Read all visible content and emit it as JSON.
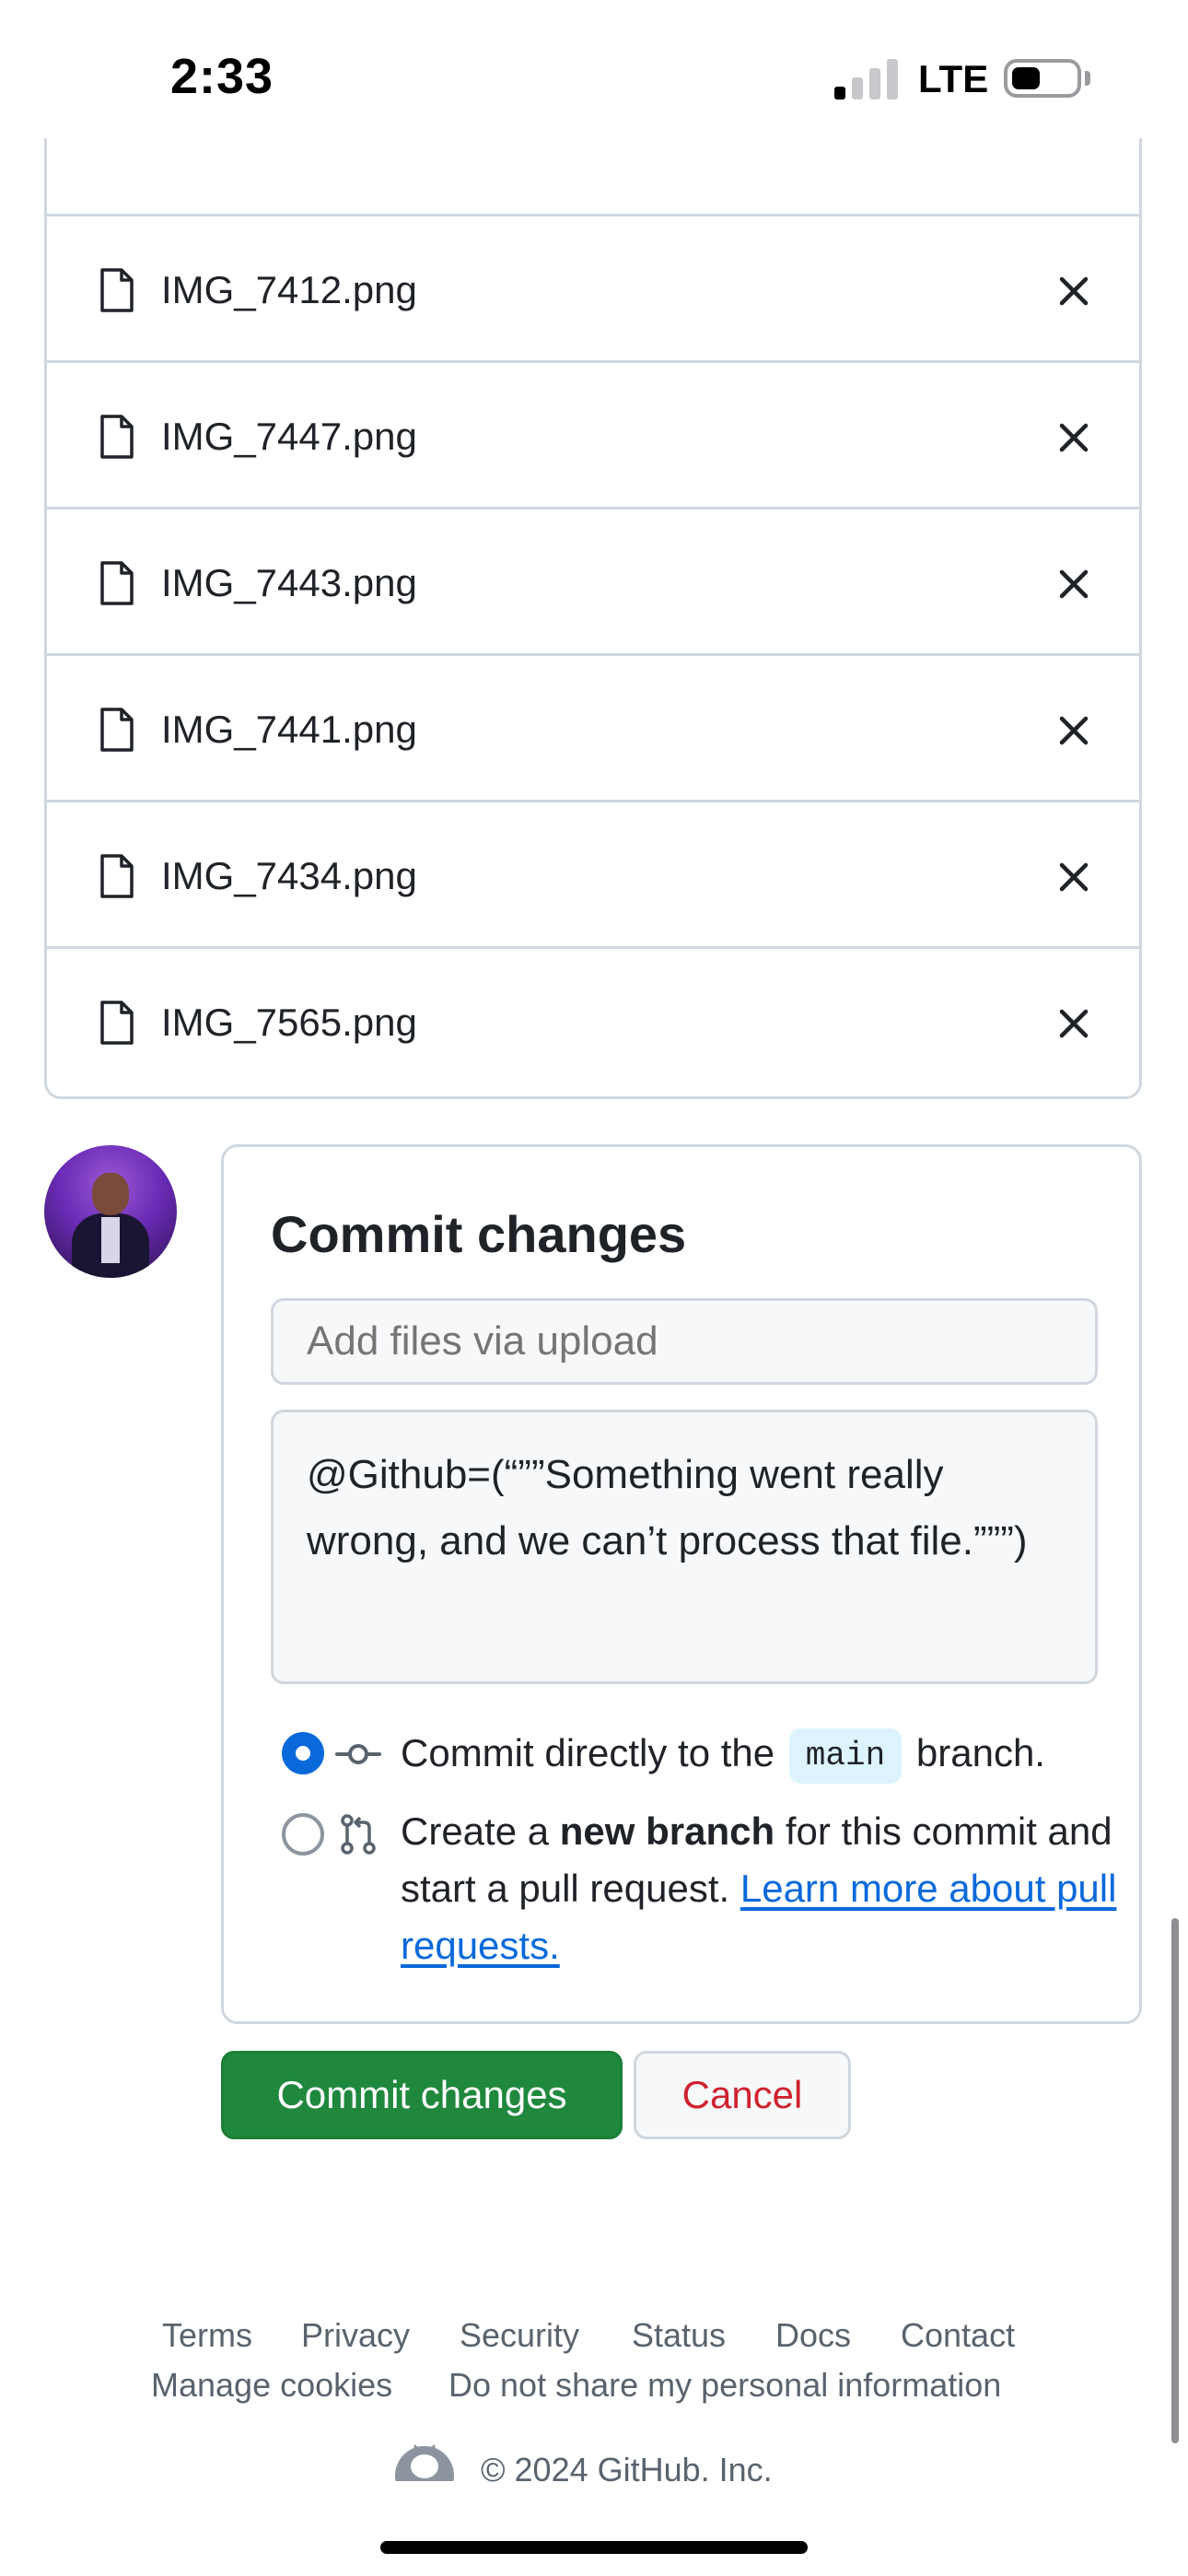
{
  "status_bar": {
    "time": "2:33",
    "network": "LTE",
    "signal_bars_active": 1,
    "signal_bars_total": 4
  },
  "files": [
    {
      "name": "IMG_7412.png"
    },
    {
      "name": "IMG_7447.png"
    },
    {
      "name": "IMG_7443.png"
    },
    {
      "name": "IMG_7441.png"
    },
    {
      "name": "IMG_7434.png"
    },
    {
      "name": "IMG_7565.png"
    }
  ],
  "commit": {
    "title": "Commit changes",
    "summary_placeholder": "Add files via upload",
    "summary_value": "",
    "description": "@Github=(“””Something went really wrong, and we can’t process that file.”””)",
    "option_direct_prefix": "Commit directly to the",
    "branch_name": "main",
    "option_direct_suffix": "branch.",
    "option_new_prefix": "Create a",
    "option_new_bold": "new branch",
    "option_new_suffix": "for this commit and start a pull request.",
    "learn_more": "Learn more about pull requests.",
    "selected_option": "direct"
  },
  "buttons": {
    "commit": "Commit changes",
    "cancel": "Cancel"
  },
  "footer": {
    "links": [
      "Terms",
      "Privacy",
      "Security",
      "Status",
      "Docs",
      "Contact"
    ],
    "links_row2": [
      "Manage cookies",
      "Do not share my personal information"
    ],
    "copyright": "© 2024 GitHub. Inc."
  },
  "colors": {
    "accent": "#0969da",
    "primary_button": "#1f883d",
    "danger": "#cf222e",
    "border": "#d0d7de",
    "branch_pill_bg": "#ddf4ff"
  }
}
